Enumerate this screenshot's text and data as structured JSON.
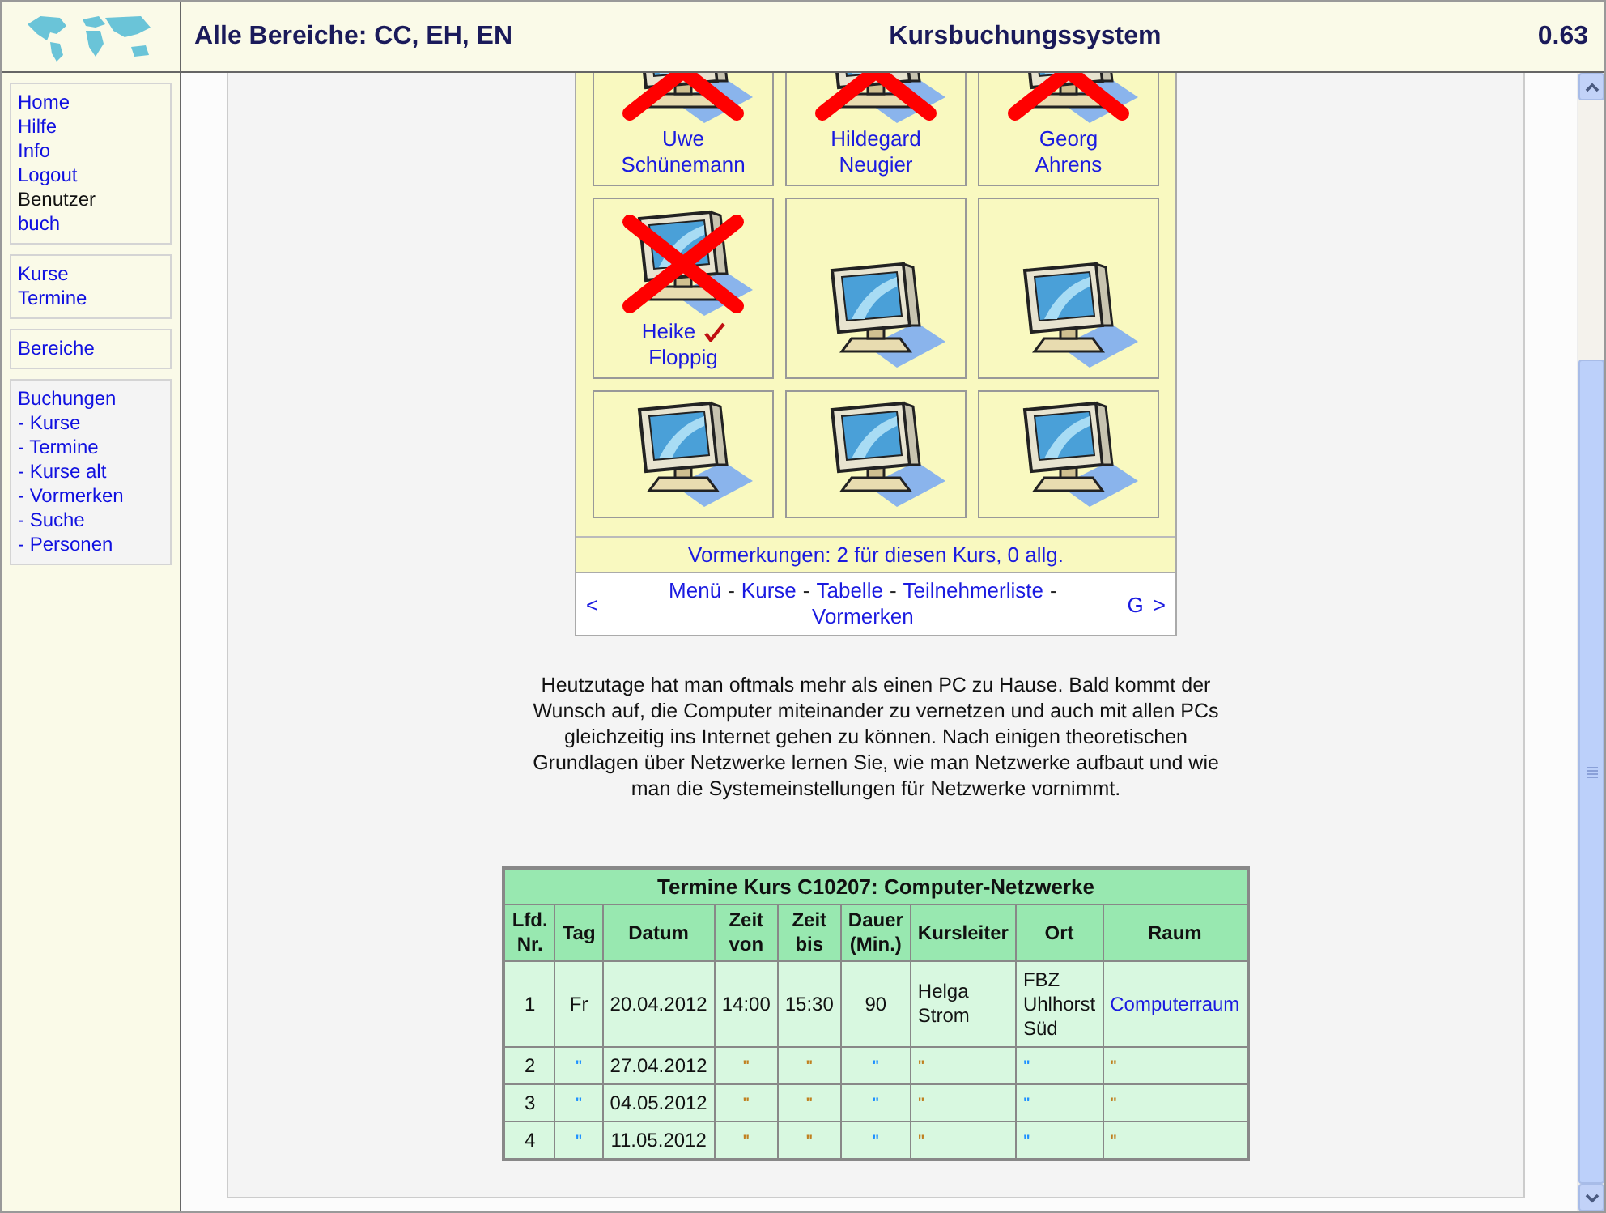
{
  "header": {
    "scope": "Alle Bereiche: CC, EH, EN",
    "title": "Kursbuchungssystem",
    "version": "0.63"
  },
  "sidebar": {
    "groups": [
      {
        "shaded": false,
        "items": [
          {
            "label": "Home",
            "link": true
          },
          {
            "label": "Hilfe",
            "link": true
          },
          {
            "label": "Info",
            "link": true
          },
          {
            "label": "Logout",
            "link": true
          },
          {
            "label": "Benutzer",
            "link": false
          },
          {
            "label": "buch",
            "link": true
          }
        ]
      },
      {
        "shaded": false,
        "items": [
          {
            "label": "Kurse",
            "link": true
          },
          {
            "label": "Termine",
            "link": true
          }
        ]
      },
      {
        "shaded": false,
        "items": [
          {
            "label": "Bereiche",
            "link": true
          }
        ]
      },
      {
        "shaded": true,
        "items": [
          {
            "label": "Buchungen",
            "link": true
          },
          {
            "label": "- Kurse",
            "link": true
          },
          {
            "label": "- Termine",
            "link": true
          },
          {
            "label": "- Kurse alt",
            "link": true
          },
          {
            "label": "- Vormerken",
            "link": true
          },
          {
            "label": "- Suche",
            "link": true
          },
          {
            "label": "- Personen",
            "link": true
          }
        ]
      }
    ]
  },
  "seat_rows": [
    {
      "cut_off": true,
      "seats": [
        {
          "name": [
            "Uwe",
            "Schünemann"
          ],
          "booked": true,
          "checked": false
        },
        {
          "name": [
            "Hildegard",
            "Neugier"
          ],
          "booked": true,
          "checked": false
        },
        {
          "name": [
            "Georg",
            "Ahrens"
          ],
          "booked": true,
          "checked": false
        }
      ]
    },
    {
      "cut_off": false,
      "seats": [
        {
          "name": [
            "Heike",
            "Floppig"
          ],
          "booked": true,
          "checked": true
        },
        {
          "booked": false,
          "checked": false
        },
        {
          "booked": false,
          "checked": false
        }
      ]
    },
    {
      "cut_off": false,
      "seats": [
        {
          "booked": false,
          "checked": false
        },
        {
          "booked": false,
          "checked": false
        },
        {
          "booked": false,
          "checked": false
        }
      ]
    }
  ],
  "reservations": "Vormerkungen: 2 für diesen Kurs, 0 allg.",
  "nav": {
    "prev": "<",
    "links": [
      {
        "kind": "link",
        "text": "Menü"
      },
      {
        "kind": "sep",
        "text": "-"
      },
      {
        "kind": "link",
        "text": "Kurse"
      },
      {
        "kind": "sep",
        "text": "-"
      },
      {
        "kind": "link",
        "text": "Tabelle"
      },
      {
        "kind": "sep",
        "text": "-"
      },
      {
        "kind": "link",
        "text": "Teilnehmerliste"
      },
      {
        "kind": "sep",
        "text": "-"
      },
      {
        "kind": "link",
        "text": "Vormerken"
      }
    ],
    "letter": "G",
    "next": ">"
  },
  "description": "Heutzutage hat man oftmals mehr als einen PC zu Hause. Bald kommt der Wunsch auf, die Computer miteinander zu vernetzen und auch mit allen PCs gleichzeitig ins Internet gehen zu können. Nach einigen theoretischen Grundlagen über Netzwerke lernen Sie, wie man Netzwerke aufbaut und wie man die Systemeinstellungen für Netzwerke vornimmt.",
  "table": {
    "title": "Termine Kurs C10207: Computer-Netzwerke",
    "columns": [
      "Lfd. Nr.",
      "Tag",
      "Datum",
      "Zeit von",
      "Zeit bis",
      "Dauer (Min.)",
      "Kursleiter",
      "Ort",
      "Raum"
    ],
    "rows": [
      [
        {
          "kind": "text",
          "text": "1"
        },
        {
          "kind": "text",
          "text": "Fr"
        },
        {
          "kind": "text",
          "text": "20.04.2012"
        },
        {
          "kind": "text",
          "text": "14:00"
        },
        {
          "kind": "text",
          "text": "15:30"
        },
        {
          "kind": "text",
          "text": "90"
        },
        {
          "kind": "left",
          "text": "Helga Strom"
        },
        {
          "kind": "left",
          "text": "FBZ Uhlhorst Süd"
        },
        {
          "kind": "link",
          "text": "Computerraum"
        }
      ],
      [
        {
          "kind": "text",
          "text": "2"
        },
        {
          "kind": "ditto",
          "text": "\"",
          "color": "#1e90ff"
        },
        {
          "kind": "text",
          "text": "27.04.2012"
        },
        {
          "kind": "ditto",
          "text": "\"",
          "color": "#c08020"
        },
        {
          "kind": "ditto",
          "text": "\"",
          "color": "#c08020"
        },
        {
          "kind": "ditto",
          "text": "\"",
          "color": "#1e90ff"
        },
        {
          "kind": "dittoleft",
          "text": "\"",
          "color": "#c08020"
        },
        {
          "kind": "dittoleft",
          "text": "\"",
          "color": "#1e90ff"
        },
        {
          "kind": "dittoleft",
          "text": "\"",
          "color": "#c08020"
        }
      ],
      [
        {
          "kind": "text",
          "text": "3"
        },
        {
          "kind": "ditto",
          "text": "\"",
          "color": "#1e90ff"
        },
        {
          "kind": "text",
          "text": "04.05.2012"
        },
        {
          "kind": "ditto",
          "text": "\"",
          "color": "#c08020"
        },
        {
          "kind": "ditto",
          "text": "\"",
          "color": "#c08020"
        },
        {
          "kind": "ditto",
          "text": "\"",
          "color": "#1e90ff"
        },
        {
          "kind": "dittoleft",
          "text": "\"",
          "color": "#c08020"
        },
        {
          "kind": "dittoleft",
          "text": "\"",
          "color": "#1e90ff"
        },
        {
          "kind": "dittoleft",
          "text": "\"",
          "color": "#c08020"
        }
      ],
      [
        {
          "kind": "text",
          "text": "4"
        },
        {
          "kind": "ditto",
          "text": "\"",
          "color": "#1e90ff"
        },
        {
          "kind": "text",
          "text": "11.05.2012"
        },
        {
          "kind": "ditto",
          "text": "\"",
          "color": "#c08020"
        },
        {
          "kind": "ditto",
          "text": "\"",
          "color": "#c08020"
        },
        {
          "kind": "ditto",
          "text": "\"",
          "color": "#1e90ff"
        },
        {
          "kind": "dittoleft",
          "text": "\"",
          "color": "#c08020"
        },
        {
          "kind": "dittoleft",
          "text": "\"",
          "color": "#1e90ff"
        },
        {
          "kind": "dittoleft",
          "text": "\"",
          "color": "#c08020"
        }
      ]
    ]
  }
}
